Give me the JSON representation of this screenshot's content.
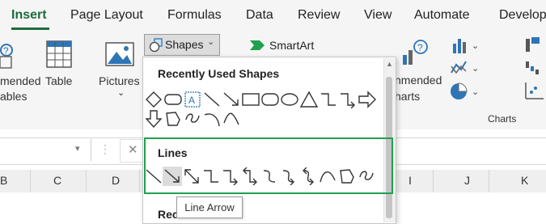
{
  "tabs": [
    "Insert",
    "Page Layout",
    "Formulas",
    "Data",
    "Review",
    "View",
    "Automate",
    "Develop"
  ],
  "ribbon": {
    "recommended_tables_label_1": "mended",
    "recommended_tables_label_2": "ables",
    "table_label": "Table",
    "pictures_label": "Pictures",
    "shapes_label": "Shapes",
    "smartart_label": "SmartArt",
    "recommended_charts_label_1": "nmended",
    "recommended_charts_label_2": "harts",
    "charts_group_label": "Charts"
  },
  "columns": [
    "B",
    "C",
    "D",
    "I",
    "J",
    "K"
  ],
  "dropdown": {
    "recently_used_title": "Recently Used Shapes",
    "lines_title": "Lines",
    "rectangles_title_partial": "Rec"
  },
  "tooltip": "Line Arrow",
  "colors": {
    "accent_green": "#1e6b3c",
    "highlight_green": "#21a04f",
    "icon_blue": "#2e75b6"
  }
}
